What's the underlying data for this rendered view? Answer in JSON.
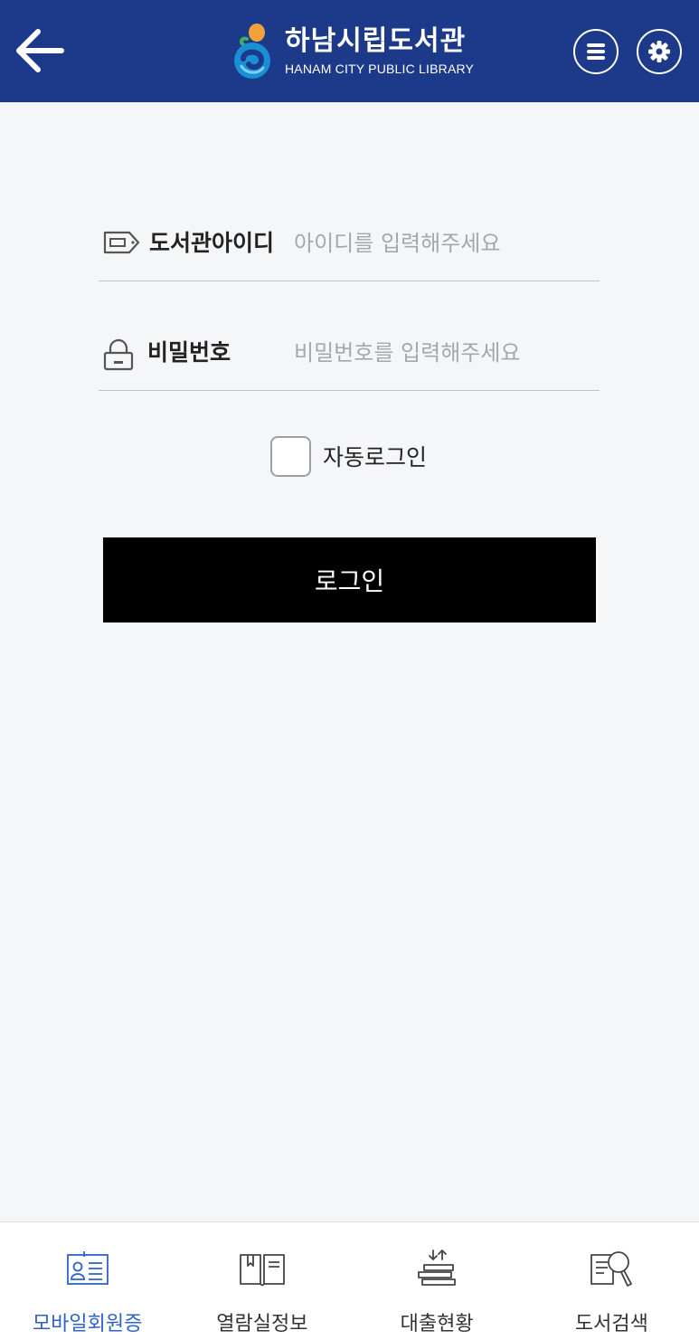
{
  "header": {
    "title": "하남시립도서관",
    "subtitle": "HANAM CITY PUBLIC LIBRARY",
    "back_icon": "arrow-left-icon",
    "menu_icon": "menu-icon",
    "settings_icon": "gear-icon",
    "bg_color": "#1d3a8a"
  },
  "form": {
    "id_label": "도서관아이디",
    "id_placeholder": "아이디를 입력해주세요",
    "id_value": "",
    "pw_label": "비밀번호",
    "pw_placeholder": "비밀번호를 입력해주세요",
    "pw_value": "",
    "auto_login_label": "자동로그인",
    "auto_login_checked": false,
    "login_button": "로그인"
  },
  "bottom_nav": {
    "items": [
      {
        "label": "모바일회원증",
        "icon": "member-card-icon",
        "active": true
      },
      {
        "label": "열람실정보",
        "icon": "open-book-icon",
        "active": false
      },
      {
        "label": "대출현황",
        "icon": "book-stack-icon",
        "active": false
      },
      {
        "label": "도서검색",
        "icon": "book-search-icon",
        "active": false
      }
    ],
    "active_color": "#2f63c8"
  }
}
